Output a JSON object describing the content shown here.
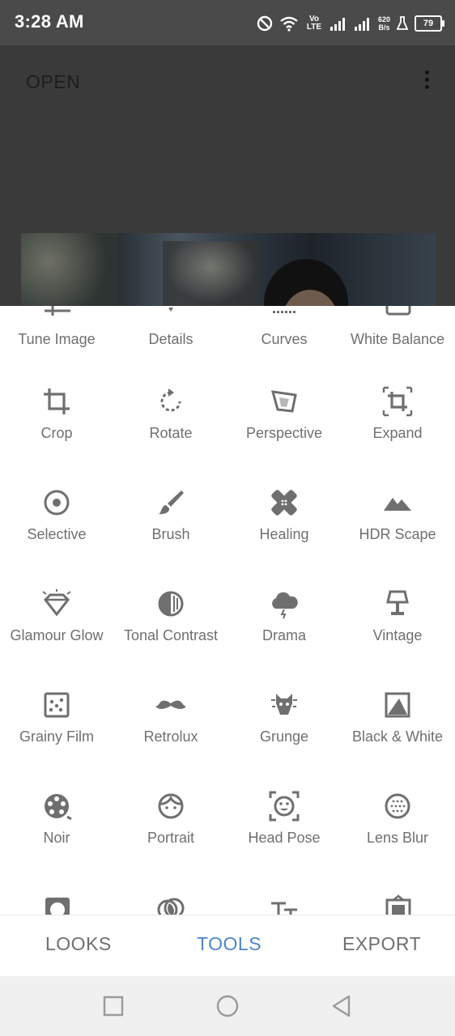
{
  "status": {
    "time": "3:28 AM",
    "net_speed_top": "620",
    "net_speed_bottom": "B/s",
    "battery": "79",
    "volte": "Vo LTE"
  },
  "header": {
    "open_label": "OPEN"
  },
  "tools": [
    {
      "label": "Tune Image",
      "icon": "tune-icon"
    },
    {
      "label": "Details",
      "icon": "details-icon"
    },
    {
      "label": "Curves",
      "icon": "curves-icon"
    },
    {
      "label": "White Balance",
      "icon": "white-balance-icon"
    },
    {
      "label": "Crop",
      "icon": "crop-icon"
    },
    {
      "label": "Rotate",
      "icon": "rotate-icon"
    },
    {
      "label": "Perspective",
      "icon": "perspective-icon"
    },
    {
      "label": "Expand",
      "icon": "expand-icon"
    },
    {
      "label": "Selective",
      "icon": "selective-icon"
    },
    {
      "label": "Brush",
      "icon": "brush-icon"
    },
    {
      "label": "Healing",
      "icon": "healing-icon"
    },
    {
      "label": "HDR Scape",
      "icon": "hdr-icon"
    },
    {
      "label": "Glamour Glow",
      "icon": "glamour-glow-icon"
    },
    {
      "label": "Tonal Contrast",
      "icon": "tonal-contrast-icon"
    },
    {
      "label": "Drama",
      "icon": "drama-icon"
    },
    {
      "label": "Vintage",
      "icon": "vintage-icon"
    },
    {
      "label": "Grainy Film",
      "icon": "grainy-film-icon"
    },
    {
      "label": "Retrolux",
      "icon": "retrolux-icon"
    },
    {
      "label": "Grunge",
      "icon": "grunge-icon"
    },
    {
      "label": "Black & White",
      "icon": "black-white-icon"
    },
    {
      "label": "Noir",
      "icon": "noir-icon"
    },
    {
      "label": "Portrait",
      "icon": "portrait-icon"
    },
    {
      "label": "Head Pose",
      "icon": "head-pose-icon"
    },
    {
      "label": "Lens Blur",
      "icon": "lens-blur-icon"
    }
  ],
  "bottom_tabs": {
    "looks": "LOOKS",
    "tools": "TOOLS",
    "export": "EXPORT"
  },
  "colors": {
    "accent": "#4d87c9",
    "icon_gray": "#6f6f6f",
    "status_bg": "#4a4a4a"
  }
}
